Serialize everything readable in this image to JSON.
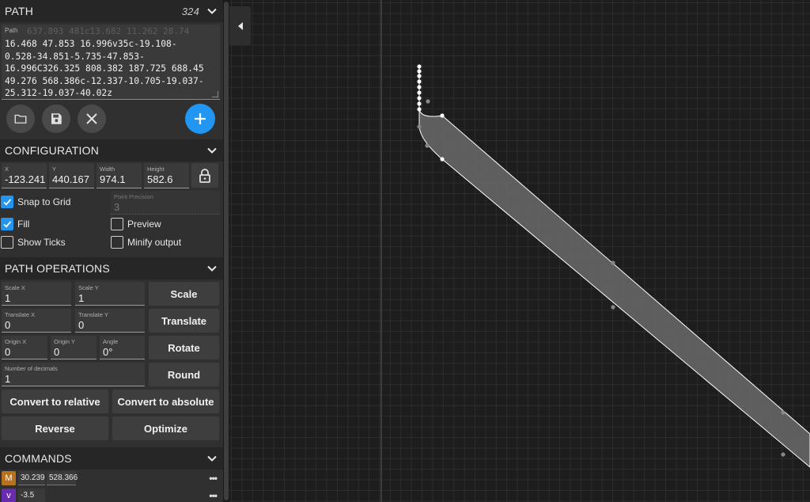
{
  "path_section": {
    "title": "PATH",
    "count": "324",
    "field_label": "Path",
    "ghost_text": "637.893 481c13.682 11.262 28.74",
    "text": "16.468 47.853 16.996v35c-19.108-\n0.528-34.851-5.735-47.853-\n16.996C326.325 808.382 187.725 688.45\n49.276 568.386c-12.337-10.705-19.037-\n25.312-19.037-40.02z"
  },
  "toolbar": {
    "open_icon": "folder-icon",
    "save_icon": "save-icon",
    "clear_icon": "close-icon",
    "add_icon": "plus-icon"
  },
  "configuration": {
    "title": "CONFIGURATION",
    "x_label": "X",
    "x_value": "-123.241",
    "y_label": "Y",
    "y_value": "440.167",
    "width_label": "Width",
    "width_value": "974.1",
    "height_label": "Height",
    "height_value": "582.6",
    "snap_label": "Snap to Grid",
    "snap_checked": true,
    "precision_label": "Point Precision",
    "precision_value": "3",
    "fill_label": "Fill",
    "fill_checked": true,
    "preview_label": "Preview",
    "preview_checked": false,
    "ticks_label": "Show Ticks",
    "ticks_checked": false,
    "minify_label": "Minify output",
    "minify_checked": false
  },
  "path_operations": {
    "title": "PATH OPERATIONS",
    "scale_x_label": "Scale X",
    "scale_x_value": "1",
    "scale_y_label": "Scale Y",
    "scale_y_value": "1",
    "scale_button": "Scale",
    "translate_x_label": "Translate X",
    "translate_x_value": "0",
    "translate_y_label": "Translate Y",
    "translate_y_value": "0",
    "translate_button": "Translate",
    "origin_x_label": "Origin X",
    "origin_x_value": "0",
    "origin_y_label": "Origin Y",
    "origin_y_value": "0",
    "angle_label": "Angle",
    "angle_value": "0°",
    "rotate_button": "Rotate",
    "decimals_label": "Number of decimals",
    "decimals_value": "1",
    "round_button": "Round",
    "to_relative_button": "Convert to relative",
    "to_absolute_button": "Convert to absolute",
    "reverse_button": "Reverse",
    "optimize_button": "Optimize"
  },
  "commands": {
    "title": "COMMANDS",
    "rows": [
      {
        "letter": "M",
        "color": "#b8711f",
        "values": [
          "30.239",
          "528.366"
        ],
        "menu": "•••"
      },
      {
        "letter": "v",
        "color": "#6a2cae",
        "values": [
          "-3.5"
        ],
        "menu": "•••"
      }
    ]
  },
  "colors": {
    "accent": "#2196f3",
    "sidebar_bg": "#303030",
    "canvas_bg": "#1d1d1d",
    "shape_fill": "#6a6a6a"
  }
}
